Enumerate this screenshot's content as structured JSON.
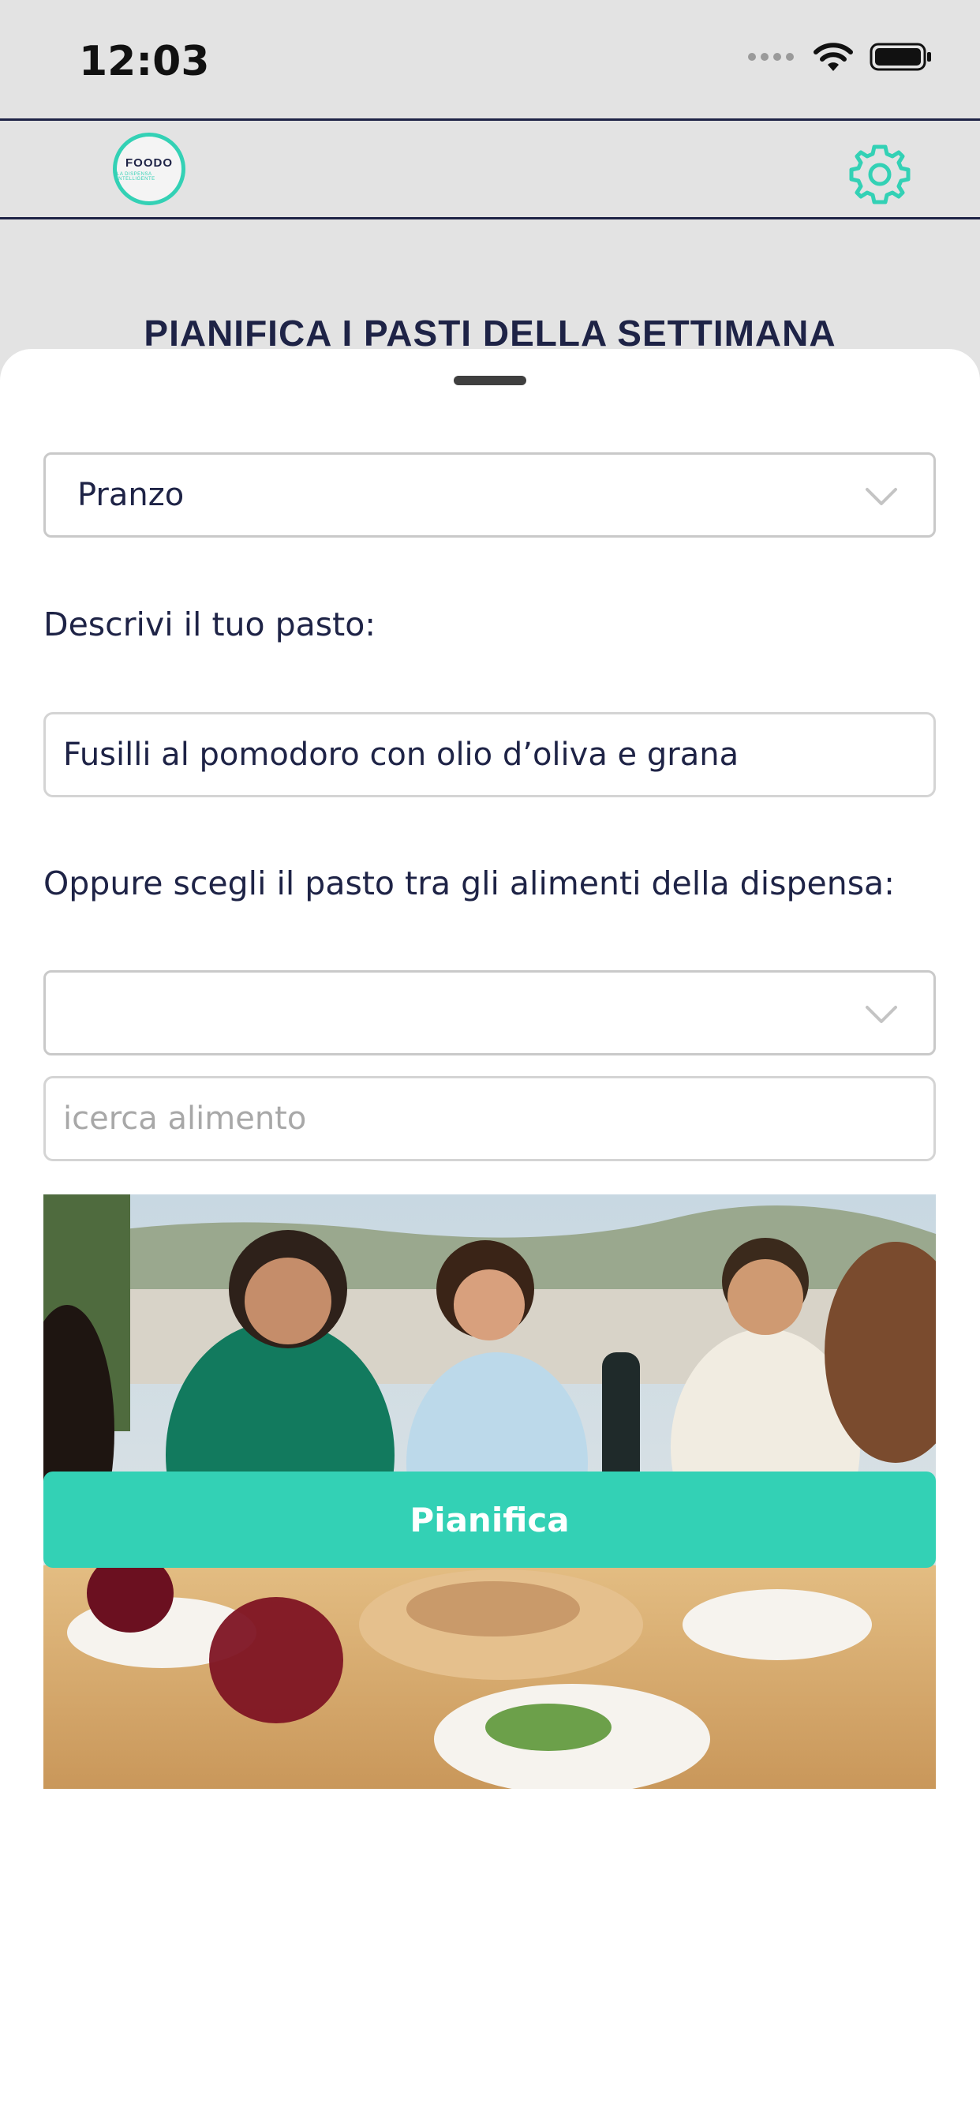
{
  "status_bar": {
    "time": "12:03"
  },
  "header": {
    "logo_text": "FOODO",
    "logo_tagline": "LA DISPENSA INTELLIGENTE",
    "settings_icon": "gear-icon",
    "accent_color": "#33d1b5",
    "navy_color": "#1e2346"
  },
  "page": {
    "title": "PIANIFICA I PASTI DELLA SETTIMANA"
  },
  "form": {
    "meal_type_selected": "Pranzo",
    "describe_label": "Descrivi il tuo pasto:",
    "meal_description_value": "Fusilli al pomodoro con olio d’oliva e grana",
    "pantry_label": "Oppure scegli il pasto tra gli alimenti della dispensa:",
    "pantry_select_value": "",
    "search_placeholder": "icerca alimento",
    "submit_label": "Pianifica"
  }
}
